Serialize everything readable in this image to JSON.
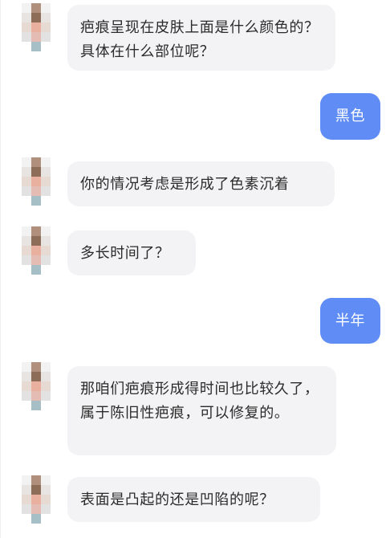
{
  "messages": [
    {
      "sender": "doctor",
      "text": "疤痕呈现在皮肤上面是什么颜色的？ 具体在什么部位呢？"
    },
    {
      "sender": "user",
      "text": "黑色"
    },
    {
      "sender": "doctor",
      "text": "你的情况考虑是形成了色素沉着"
    },
    {
      "sender": "doctor",
      "text": "多长时间了？"
    },
    {
      "sender": "user",
      "text": "半年"
    },
    {
      "sender": "doctor",
      "text": "那咱们疤痕形成得时间也比较久了，属于陈旧性疤痕，可以修复的。"
    },
    {
      "sender": "doctor",
      "text": "表面是凸起的还是凹陷的呢？"
    }
  ],
  "colors": {
    "user_bubble": "#5f8df5",
    "doctor_bubble": "#f3f3f5"
  }
}
